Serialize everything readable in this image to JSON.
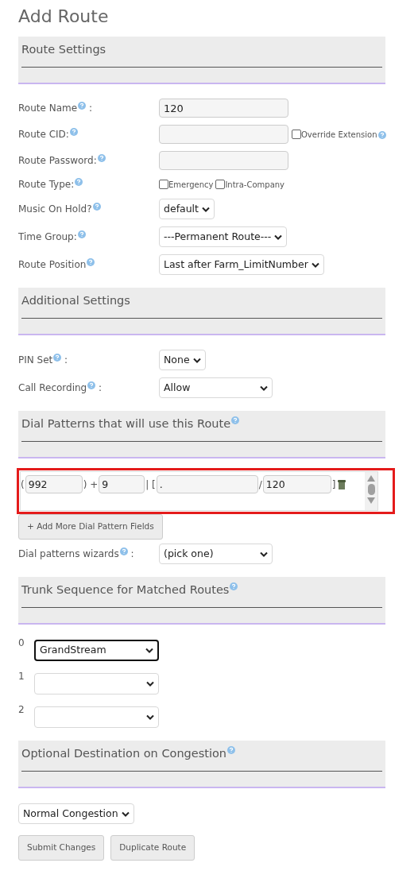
{
  "title": "Add Route",
  "sections": [
    {
      "heading": "Route Settings",
      "fields": [
        {
          "kind": "text",
          "label": "Route Name",
          "help": true,
          "suffix": ":",
          "value": "120"
        },
        {
          "kind": "text",
          "label": "Route CID:",
          "help": true,
          "checkbox": {
            "label": "Override Extension",
            "checked": false,
            "help": true
          }
        },
        {
          "kind": "text",
          "label": "Route Password:",
          "help": true
        },
        {
          "kind": "checkboxes",
          "label": "Route Type:",
          "help": true,
          "options": [
            {
              "label": "Emergency",
              "checked": false
            },
            {
              "label": "Intra-Company",
              "checked": false
            }
          ]
        },
        {
          "kind": "select",
          "label": "Music On Hold?",
          "help": true,
          "value": "default"
        },
        {
          "kind": "select",
          "label": "Time Group:",
          "help": true,
          "value": "---Permanent Route---"
        },
        {
          "kind": "select",
          "label": "Route Position",
          "help": true,
          "value": "Last after Farm_LimitNumber"
        }
      ]
    },
    {
      "heading": "Additional Settings",
      "fields": [
        {
          "kind": "select",
          "label": "PIN Set",
          "help": true,
          "suffix": ":",
          "value": "None"
        },
        {
          "kind": "select",
          "label": "Call Recording",
          "help": true,
          "suffix": ":",
          "value": "Allow"
        }
      ]
    },
    {
      "heading": "Dial Patterns that will use this Route",
      "help": true,
      "dial_patterns": [
        {
          "highlighted": true,
          "parts": [
            {
              "kind": "text",
              "text": "("
            },
            {
              "kind": "input",
              "value": "992"
            },
            {
              "kind": "text",
              "text": ") +"
            },
            {
              "kind": "input",
              "value": "9"
            },
            {
              "kind": "text",
              "text": "| ["
            },
            {
              "kind": "input",
              "value": "."
            },
            {
              "kind": "text",
              "text": "/"
            },
            {
              "kind": "input",
              "value": "120"
            },
            {
              "kind": "text",
              "text": "]"
            },
            {
              "kind": "trash"
            }
          ]
        }
      ],
      "add_button": "+ Add More Dial Pattern Fields",
      "fields": [
        {
          "kind": "select",
          "label": "Dial patterns wizards",
          "help": true,
          "suffix": ":",
          "value": "(pick one)"
        }
      ]
    },
    {
      "heading": "Trunk Sequence for Matched Routes",
      "help": true,
      "trunks": [
        {
          "index": "0",
          "value": "GrandStream",
          "focused": true
        },
        {
          "index": "1",
          "focused": false
        },
        {
          "index": "2",
          "focused": false
        }
      ]
    },
    {
      "heading": "Optional Destination on Congestion",
      "help": true,
      "congestion": "Normal Congestion"
    }
  ],
  "buttons": [
    "Submit Changes",
    "Duplicate Route"
  ]
}
